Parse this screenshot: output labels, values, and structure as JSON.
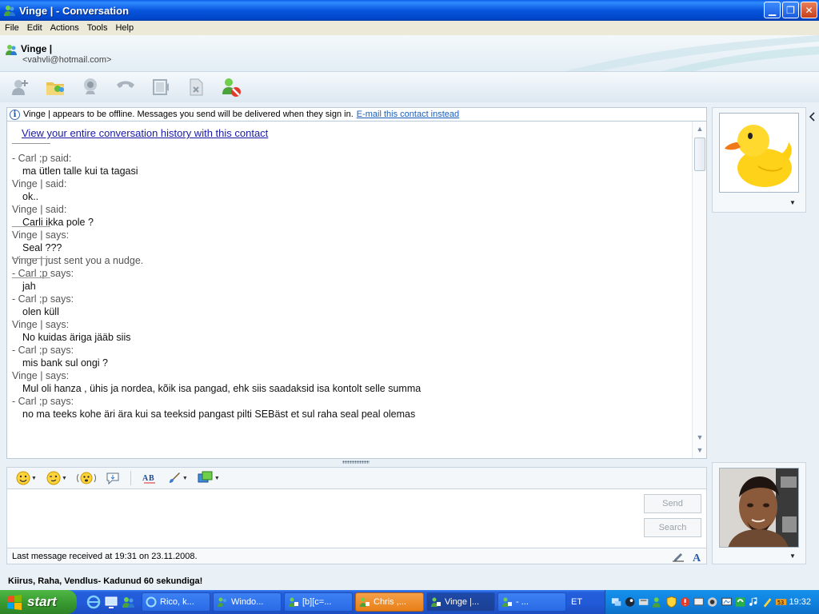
{
  "window": {
    "title": "Vinge |   - Conversation"
  },
  "menu": [
    "File",
    "Edit",
    "Actions",
    "Tools",
    "Help"
  ],
  "contact": {
    "name": "Vinge |",
    "email": "<vahvli@hotmail.com>"
  },
  "infobar": {
    "text": "Vinge | appears to be offline. Messages you send will be delivered when they sign in.",
    "link": "E-mail this contact instead"
  },
  "conversation": {
    "history_link": "View your entire conversation history with this contact",
    "lines": [
      {
        "type": "sep"
      },
      {
        "type": "sender",
        "text": "- Carl ;p said:"
      },
      {
        "type": "msg",
        "text": "ma ütlen talle kui ta tagasi"
      },
      {
        "type": "sender",
        "text": "Vinge | said:"
      },
      {
        "type": "msg",
        "text": "ok.."
      },
      {
        "type": "sender",
        "text": "Vinge | said:"
      },
      {
        "type": "msg",
        "text": "Carli ikka pole ?"
      },
      {
        "type": "sep"
      },
      {
        "type": "sender",
        "text": "Vinge | says:"
      },
      {
        "type": "msg",
        "text": "Seal ???"
      },
      {
        "type": "sep"
      },
      {
        "type": "sender",
        "text": "Vinge | just sent you a nudge."
      },
      {
        "type": "sep"
      },
      {
        "type": "sender",
        "text": "- Carl ;p says:"
      },
      {
        "type": "msg",
        "text": "jah"
      },
      {
        "type": "sender",
        "text": "- Carl ;p says:"
      },
      {
        "type": "msg",
        "text": "olen küll"
      },
      {
        "type": "sender",
        "text": "Vinge | says:"
      },
      {
        "type": "msg",
        "text": "No kuidas äriga jääb siis"
      },
      {
        "type": "sender",
        "text": "- Carl ;p says:"
      },
      {
        "type": "msg",
        "text": "mis bank sul ongi ?"
      },
      {
        "type": "sender",
        "text": "Vinge | says:"
      },
      {
        "type": "msg",
        "text": "Mul oli hanza , ühis ja nordea, kõik isa pangad, ehk siis saadaksid isa kontolt selle summa"
      },
      {
        "type": "sender",
        "text": "- Carl ;p says:"
      },
      {
        "type": "msg",
        "text": "no ma teeks kohe äri ära kui sa teeksid pangast pilti SEBäst et sul raha seal peal olemas"
      }
    ]
  },
  "input": {
    "send_label": "Send",
    "search_label": "Search"
  },
  "status": {
    "last_message": "Last message received at 19:31 on 23.11.2008."
  },
  "personal_message": "Kiirus, Raha, Vendlus- Kadunud 60 sekundiga!",
  "taskbar": {
    "start_label": "start",
    "tasks": [
      {
        "label": "Rico, k...",
        "state": "normal"
      },
      {
        "label": "Windo...",
        "state": "normal"
      },
      {
        "label": "[b][c=...",
        "state": "normal"
      },
      {
        "label": "Chris ,...",
        "state": "highlight"
      },
      {
        "label": "Vinge |...",
        "state": "active"
      },
      {
        "label": "-       ...",
        "state": "normal"
      }
    ],
    "language": "ET",
    "clock": "19:32"
  },
  "colors": {
    "accent": "#1a5dbd",
    "title_bar": "#0855dd",
    "start_green": "#36962e"
  }
}
